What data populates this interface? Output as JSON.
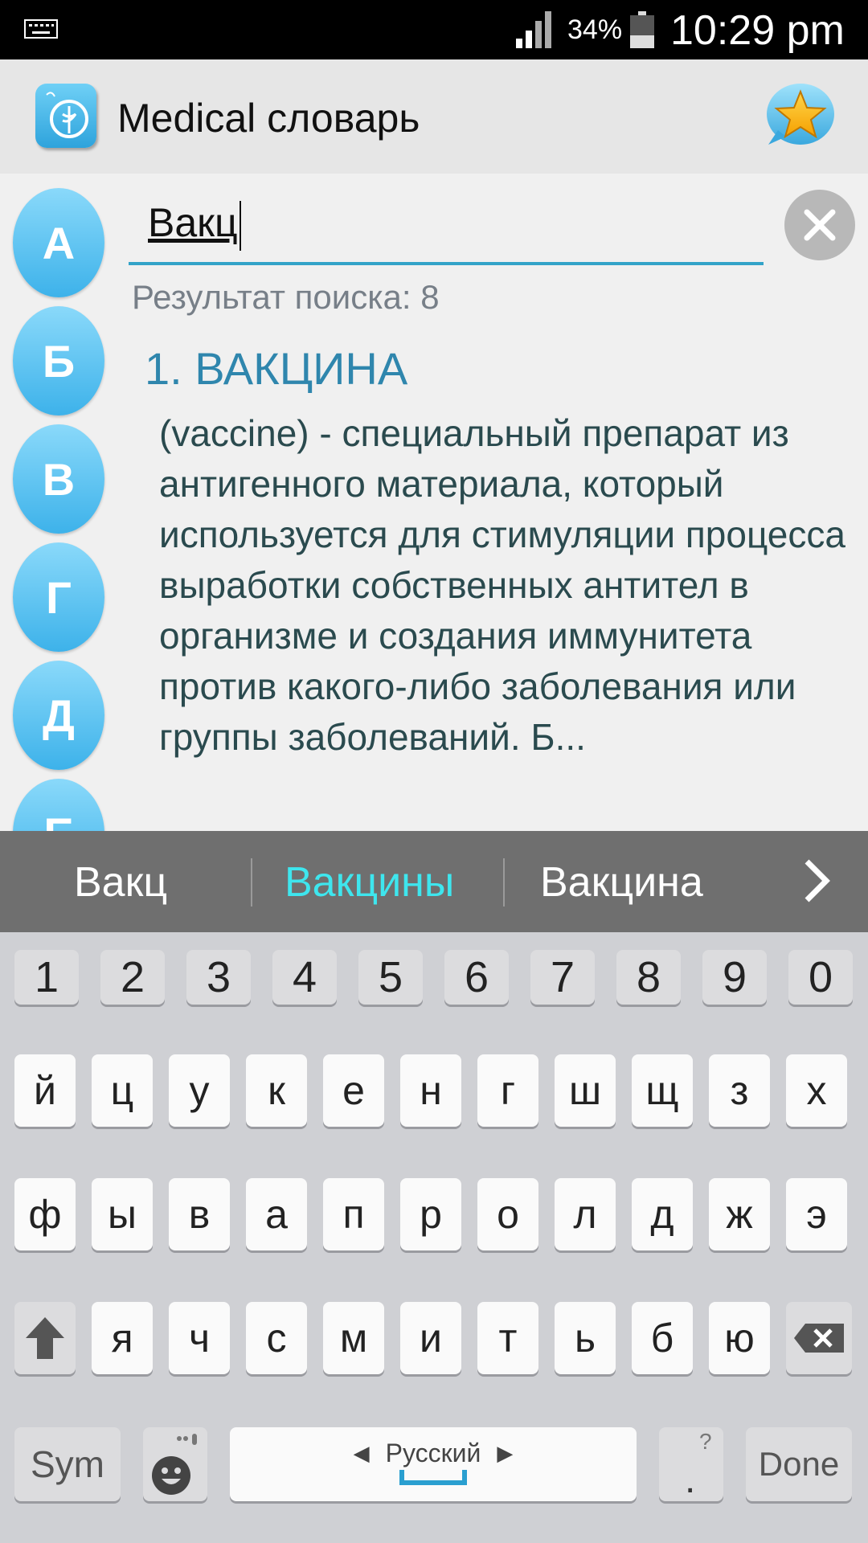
{
  "status": {
    "battery": "34%",
    "time": "10:29 pm"
  },
  "app": {
    "title": "Medical словарь"
  },
  "letters": [
    "А",
    "Б",
    "В",
    "Г",
    "Д",
    "Е"
  ],
  "search": {
    "value": "Вакц",
    "result_count": "Результат поиска: 8"
  },
  "result": {
    "title": "1. ВАКЦИНА",
    "body": "(vaccine) - специальный препарат из антигенного материала, который используется для стимуляции процесса выработки собственных антител в организме и создания иммунитета против какого-либо заболевания или группы заболеваний. Б..."
  },
  "suggestions": [
    "Вакц",
    "Вакцины",
    "Вакцина"
  ],
  "colors": {
    "accent": "#33a3c8",
    "highlight_suggestion": "#3ee6ee",
    "letter_bubble": "#5ac4f2"
  },
  "keyboard": {
    "numbers": [
      "1",
      "2",
      "3",
      "4",
      "5",
      "6",
      "7",
      "8",
      "9",
      "0"
    ],
    "row1": [
      "й",
      "ц",
      "у",
      "к",
      "е",
      "н",
      "г",
      "ш",
      "щ",
      "з",
      "х"
    ],
    "row2": [
      "ф",
      "ы",
      "в",
      "а",
      "п",
      "р",
      "о",
      "л",
      "д",
      "ж",
      "э"
    ],
    "row3": [
      "я",
      "ч",
      "с",
      "м",
      "и",
      "т",
      "ь",
      "б",
      "ю"
    ],
    "sym": "Sym",
    "space_label": "Русский",
    "period": ".",
    "period_hint": "?",
    "done": "Done"
  }
}
